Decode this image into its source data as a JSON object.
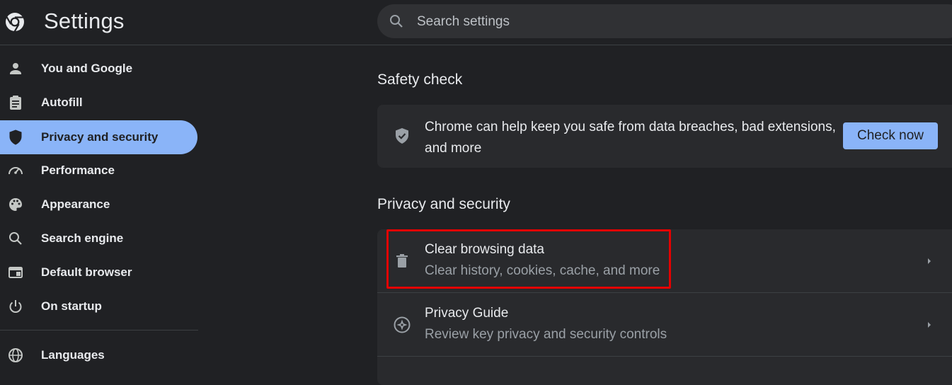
{
  "header": {
    "title": "Settings",
    "search_placeholder": "Search settings"
  },
  "sidebar": {
    "items": [
      {
        "label": "You and Google",
        "icon": "person-icon"
      },
      {
        "label": "Autofill",
        "icon": "clipboard-icon"
      },
      {
        "label": "Privacy and security",
        "icon": "shield-icon",
        "active": true
      },
      {
        "label": "Performance",
        "icon": "speedometer-icon"
      },
      {
        "label": "Appearance",
        "icon": "palette-icon"
      },
      {
        "label": "Search engine",
        "icon": "search-icon"
      },
      {
        "label": "Default browser",
        "icon": "browser-window-icon"
      },
      {
        "label": "On startup",
        "icon": "power-icon"
      },
      {
        "label": "Languages",
        "icon": "globe-icon"
      }
    ]
  },
  "safety_check": {
    "title": "Safety check",
    "description": "Chrome can help keep you safe from data breaches, bad extensions, and more",
    "button_label": "Check now"
  },
  "privacy": {
    "title": "Privacy and security",
    "rows": [
      {
        "title": "Clear browsing data",
        "subtitle": "Clear history, cookies, cache, and more",
        "icon": "trash-icon"
      },
      {
        "title": "Privacy Guide",
        "subtitle": "Review key privacy and security controls",
        "icon": "compass-icon"
      }
    ]
  },
  "colors": {
    "background": "#202124",
    "accent": "#8ab4f8",
    "highlight": "#e50000"
  }
}
